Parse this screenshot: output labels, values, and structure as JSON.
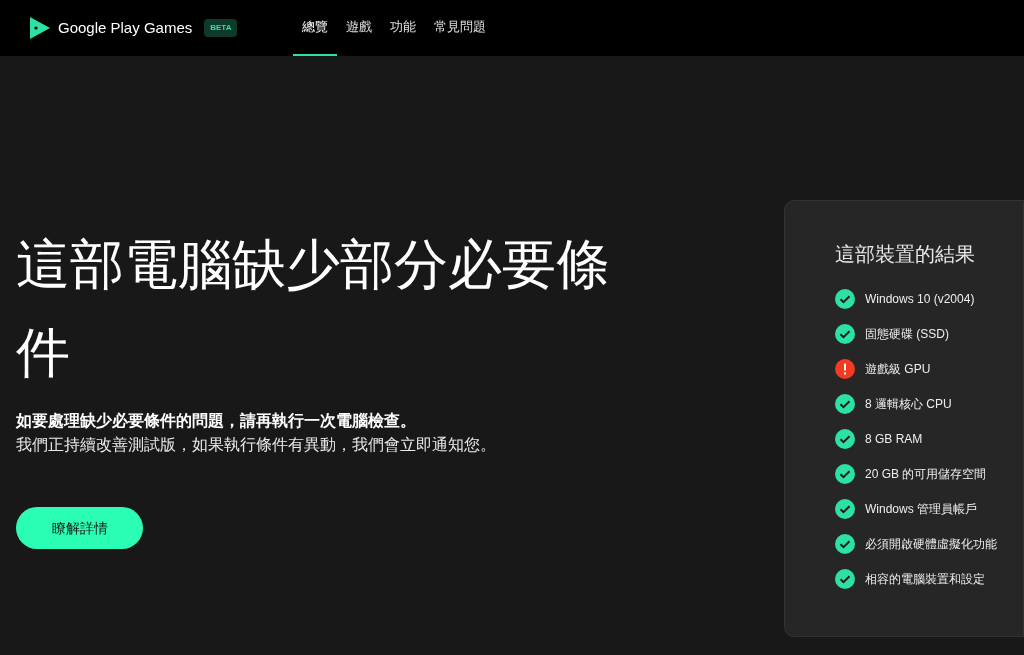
{
  "header": {
    "brand": "Google Play Games",
    "badge": "BETA",
    "nav": [
      {
        "label": "總覽",
        "selected": true
      },
      {
        "label": "遊戲",
        "selected": false
      },
      {
        "label": "功能",
        "selected": false
      },
      {
        "label": "常見問題",
        "selected": false
      }
    ]
  },
  "hero": {
    "title": "這部電腦缺少部分必要條件",
    "lead": "如要處理缺少必要條件的問題，請再執行一次電腦檢查。",
    "body": "我們正持續改善測試版，如果執行條件有異動，我們會立即通知您。",
    "button": "瞭解詳情"
  },
  "results": {
    "title": "這部裝置的結果",
    "items": [
      {
        "label": "Windows 10 (v2004)",
        "kind": "pass"
      },
      {
        "label": "固態硬碟 (SSD)",
        "kind": "pass"
      },
      {
        "label": "遊戲級 GPU",
        "kind": "fail"
      },
      {
        "label": "8 邏輯核心 CPU",
        "kind": "pass"
      },
      {
        "label": "8 GB RAM",
        "kind": "pass"
      },
      {
        "label": "20 GB 的可用儲存空間",
        "kind": "pass"
      },
      {
        "label": "Windows 管理員帳戶",
        "kind": "pass"
      },
      {
        "label": "必須開啟硬體虛擬化功能",
        "kind": "pass"
      },
      {
        "label": "相容的電腦裝置和設定",
        "kind": "pass"
      }
    ]
  }
}
